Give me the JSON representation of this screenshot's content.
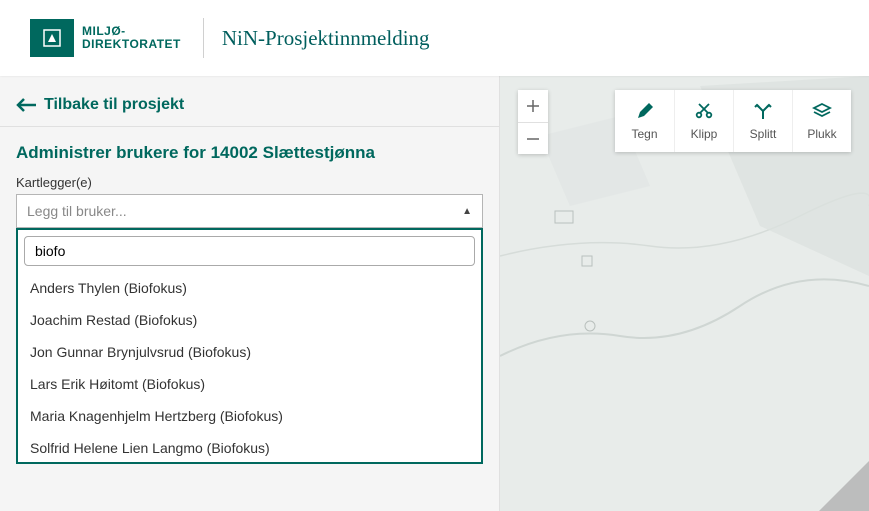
{
  "header": {
    "logo_line1": "MILJØ-",
    "logo_line2": "DIREKTORATET",
    "app_title": "NiN-Prosjektinnmelding"
  },
  "panel": {
    "back_label": "Tilbake til prosjekt",
    "title": "Administrer brukere for 14002 Slættestjønna",
    "field_label": "Kartlegger(e)",
    "placeholder": "Legg til bruker...",
    "search_value": "biofo",
    "options": [
      "Anders Thylen (Biofokus)",
      "Joachim Restad (Biofokus)",
      "Jon Gunnar Brynjulvsrud (Biofokus)",
      "Lars Erik Høitomt (Biofokus)",
      "Maria Knagenhjelm Hertzberg (Biofokus)",
      "Solfrid Helene Lien Langmo (Biofokus)"
    ]
  },
  "map_tools": {
    "tegn": "Tegn",
    "klipp": "Klipp",
    "splitt": "Splitt",
    "plukk": "Plukk"
  }
}
